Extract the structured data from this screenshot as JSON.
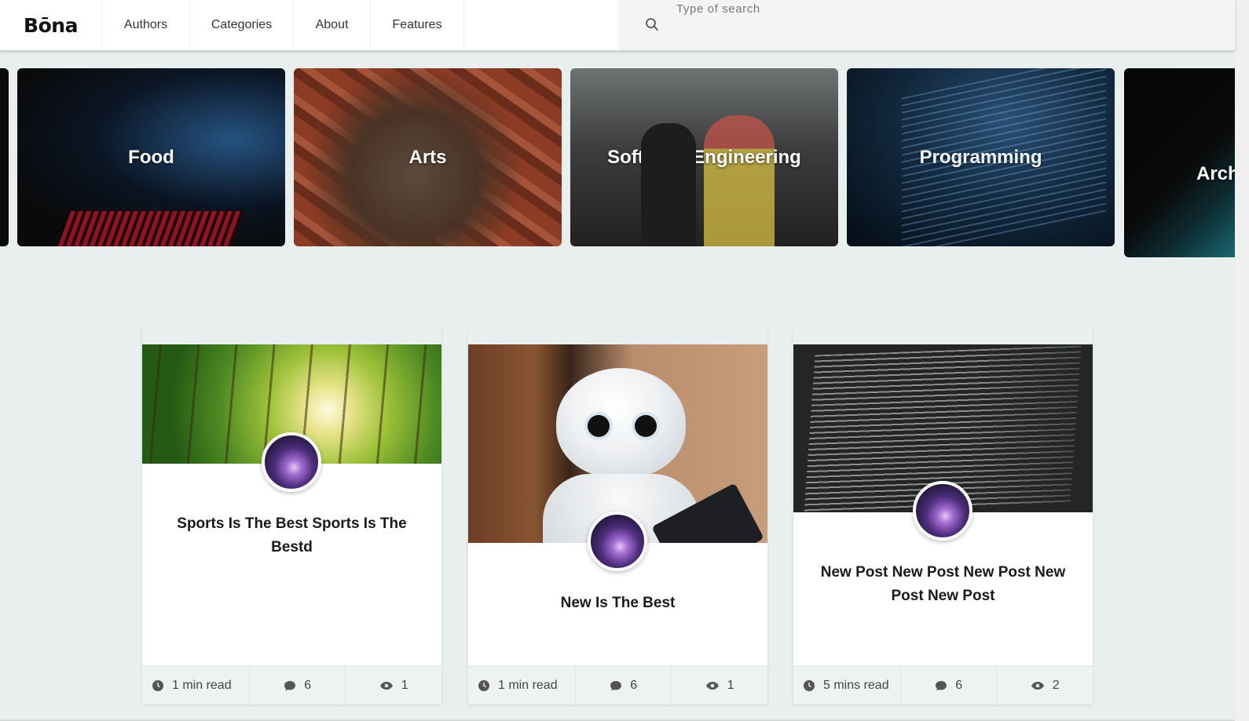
{
  "header": {
    "logo": "Bōna",
    "nav": [
      {
        "label": "Authors"
      },
      {
        "label": "Categories"
      },
      {
        "label": "About"
      },
      {
        "label": "Features"
      }
    ],
    "search": {
      "placeholder": "Type of search",
      "value": ""
    }
  },
  "categories": [
    {
      "label": "Food"
    },
    {
      "label": "Arts"
    },
    {
      "label": "Software Engineering"
    },
    {
      "label": "Programming"
    },
    {
      "label": "Arch"
    }
  ],
  "posts": [
    {
      "title": "Sports Is The Best Sports Is The Bestd",
      "read_time": "1 min read",
      "comments": "6",
      "views": "1"
    },
    {
      "title": "New Is The Best",
      "read_time": "1 min read",
      "comments": "6",
      "views": "1"
    },
    {
      "title": "New Post New Post New Post New Post New Post",
      "read_time": "5 mins read",
      "comments": "6",
      "views": "2"
    }
  ],
  "icons": {
    "search": "search-icon",
    "clock": "clock-icon",
    "comment": "comment-icon",
    "views": "eye-icon"
  }
}
